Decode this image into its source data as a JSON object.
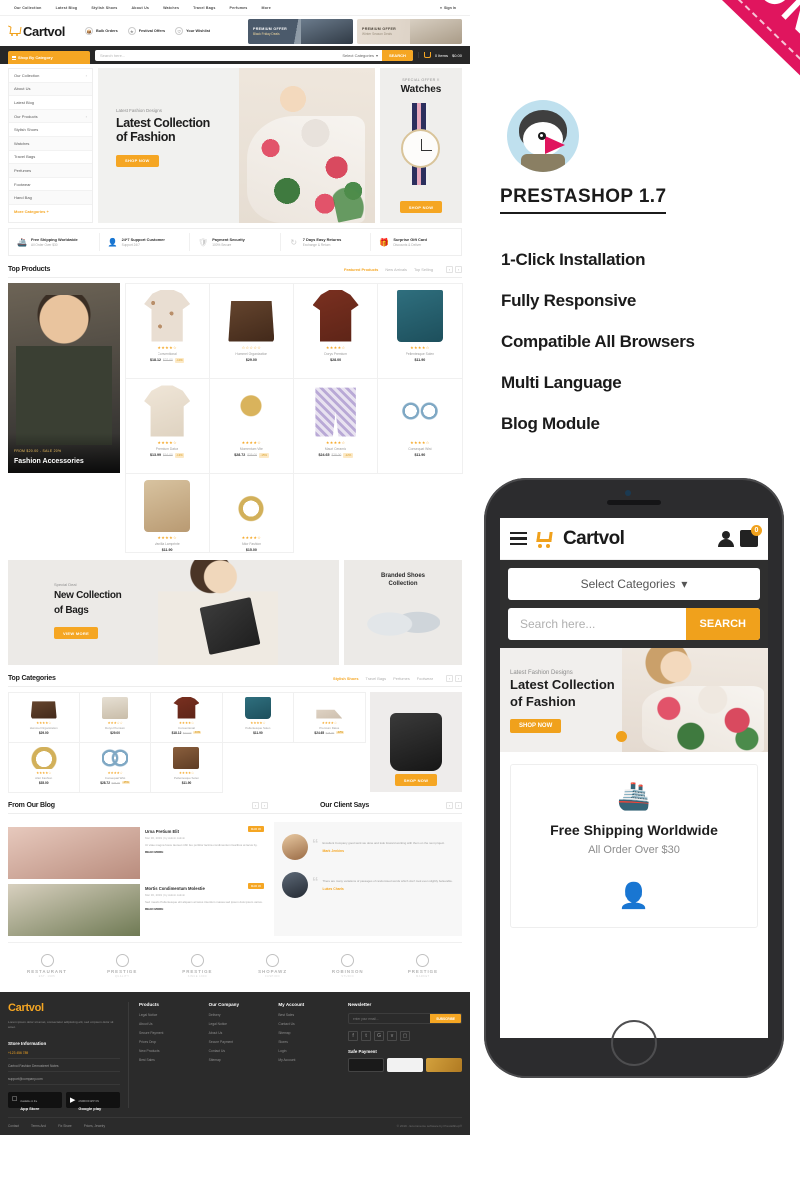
{
  "desktop": {
    "top_nav": {
      "links": [
        "Our Collection",
        "Latest Blog",
        "Stylish Shoes",
        "About Us",
        "Watches",
        "Travel Bags",
        "Perfumes",
        "More"
      ],
      "signin": "Sign In"
    },
    "brand": {
      "name": "Cartvol",
      "cart_icon": "shopping-cart-icon"
    },
    "header_features": [
      {
        "icon": "bulk-orders-icon",
        "label": "Bulk Orders"
      },
      {
        "icon": "festival-offers-icon",
        "label": "Festival Offers"
      },
      {
        "icon": "wishlist-icon",
        "label": "Your Wishlist"
      }
    ],
    "header_banners": [
      {
        "title": "PREMIUM OFFER",
        "subtitle": "Black Friday Deals"
      },
      {
        "title": "PREMIUM OFFER",
        "subtitle": "Winter Season Deals"
      }
    ],
    "search": {
      "shop_by": "Shop By Category",
      "placeholder": "Search here...",
      "select_categories": "Select Categories",
      "button": "SEARCH",
      "cart_items": "0 Items",
      "cart_total": "$0.00"
    },
    "side_menu": [
      {
        "label": "Our Collection",
        "has_arrow": true
      },
      {
        "label": "About Us",
        "has_arrow": false
      },
      {
        "label": "Latest Blog",
        "has_arrow": false
      },
      {
        "label": "Our Products",
        "has_arrow": true
      },
      {
        "label": "Stylish Shoes",
        "has_arrow": false
      },
      {
        "label": "Watches",
        "has_arrow": false
      },
      {
        "label": "Travel Bags",
        "has_arrow": false
      },
      {
        "label": "Perfumes",
        "has_arrow": false
      },
      {
        "label": "Footwear",
        "has_arrow": false
      },
      {
        "label": "Hand Bag",
        "has_arrow": false
      },
      {
        "label": "More Categories +",
        "has_arrow": false
      }
    ],
    "hero": {
      "pretitle": "Latest Fashion Designs",
      "line1": "Latest Collection",
      "line2": "of Fashion",
      "cta": "SHOP NOW"
    },
    "watch_panel": {
      "pretitle": "SPECIAL OFFER !!",
      "title": "Watches",
      "cta": "SHOP NOW"
    },
    "services": [
      {
        "icon": "ship-icon",
        "title": "Free Shipping Worldwide",
        "sub": "All Order Over $30"
      },
      {
        "icon": "support-icon",
        "title": "24*7 Support Customer",
        "sub": "Support 24/7"
      },
      {
        "icon": "shield-icon",
        "title": "Payment Security",
        "sub": "100% Secure"
      },
      {
        "icon": "return-icon",
        "title": "7 Days Easy Returns",
        "sub": "Exchange & Return"
      },
      {
        "icon": "gift-icon",
        "title": "Surprise Gift Card",
        "sub": "Discounts & Deliver"
      }
    ],
    "top_products": {
      "title": "Top Products",
      "tabs": [
        "Featured Products",
        "New Arrivals",
        "Top Selling"
      ],
      "active_tab": "Featured Products",
      "featured_card": {
        "tag": "FROM $20.00 - SALE 20%",
        "title": "Fashion Accessories"
      },
      "items": [
        {
          "shape": "sh-shirt",
          "stars": "★★★★☆",
          "name": "Conventional",
          "price": "$18.12",
          "old": "$22.00",
          "off": "-10%"
        },
        {
          "shape": "sh-bag",
          "stars": "☆☆☆☆☆",
          "name": "Hummel Organization",
          "price": "$29.00",
          "old": "",
          "off": ""
        },
        {
          "shape": "sh-tshirt",
          "stars": "★★★★☆",
          "name": "Dorys Premium",
          "price": "$28.00",
          "old": "",
          "off": ""
        },
        {
          "shape": "sh-tote",
          "stars": "★★★★☆",
          "name": "Pellentesque Solen",
          "price": "$11.90",
          "old": "",
          "off": ""
        },
        {
          "shape": "sh-sweater",
          "stars": "★★★★☆",
          "name": "Premium Datus",
          "price": "$13.99",
          "old": "$16.00",
          "off": "-13%"
        },
        {
          "shape": "sh-ear",
          "stars": "★★★★☆",
          "name": "Momentum Vite",
          "price": "$28.72",
          "old": "$35.00",
          "off": "-15%"
        },
        {
          "shape": "sh-short",
          "stars": "★★★★☆",
          "name": "Mauri Ceramic",
          "price": "$24.65",
          "old": "$28.00",
          "off": "-12%"
        },
        {
          "shape": "sh-glass",
          "stars": "★★★★☆",
          "name": "Consequat Wist",
          "price": "$11.90",
          "old": "",
          "off": ""
        },
        {
          "shape": "sh-hbag",
          "stars": "★★★★☆",
          "name": "Vanilla Lamprinte",
          "price": "$11.90",
          "old": "",
          "off": ""
        },
        {
          "shape": "sh-ring",
          "stars": "★★★★☆",
          "name": "Altor Fashion",
          "price": "$15.00",
          "old": "",
          "off": ""
        }
      ]
    },
    "promo_banners": {
      "left": {
        "pretitle": "Special Deal",
        "line1": "New Collection",
        "line2": "of Bags",
        "cta": "VIEW MORE"
      },
      "right": {
        "line1": "Branded Shoes",
        "line2": "Collection"
      }
    },
    "top_categories": {
      "title": "Top Categories",
      "tabs": [
        "Stylish Shoes",
        "Travel Bags",
        "Perfumes",
        "Footwear"
      ],
      "active_tab": "Stylish Shoes",
      "items": [
        {
          "shape": "sh-bag",
          "stars": "★★★★☆",
          "name": "Hummel Organization",
          "price": "$29.00",
          "old": "",
          "off": ""
        },
        {
          "shape": "sh-perf",
          "stars": "★★★☆☆",
          "name": "Dorys Premium",
          "price": "$29.00",
          "old": "",
          "off": ""
        },
        {
          "shape": "sh-tshirt",
          "stars": "★★★★☆",
          "name": "Conventional",
          "price": "$18.12",
          "old": "$22.00",
          "off": "-10%"
        },
        {
          "shape": "sh-tote",
          "stars": "★★★★☆",
          "name": "Pellentesque Solen",
          "price": "$11.90",
          "old": "",
          "off": ""
        },
        {
          "shape": "sh-heels",
          "stars": "★★★★☆",
          "name": "Premium Datus",
          "price": "$24.65",
          "old": "$28.00",
          "off": "-12%"
        },
        {
          "shape": "sh-ring",
          "stars": "★★★★☆",
          "name": "Altor Fashion",
          "price": "$35.00",
          "old": "",
          "off": ""
        },
        {
          "shape": "sh-glass",
          "stars": "★★★★☆",
          "name": "Consequat Wist",
          "price": "$28.72",
          "old": "$35.00",
          "off": "-15%"
        },
        {
          "shape": "sh-wallet",
          "stars": "★★★★☆",
          "name": "Pellentesque Solen",
          "price": "$11.90",
          "old": "",
          "off": ""
        }
      ],
      "big_card_cta": "SHOP NOW"
    },
    "blog": {
      "title": "From Our Blog",
      "posts": [
        {
          "date_badge": "MAR 30",
          "title": "Urna Pretium Elit",
          "meta": "Mar 30, 2019  |  by Admin Admin",
          "excerpt": "Ut vitae magna fusce laoreet nibh feu porttitor lacinia condimentum faucibus at lacus by.",
          "read_more": "READ MORE",
          "thumb": "bt-1"
        },
        {
          "date_badge": "MAR 30",
          "title": "Mortis Condimentum Molestie",
          "meta": "Mar 30, 2019  |  by Admin Admin",
          "excerpt": "Sed mauris Pellentesque elit aliquam at lacus interdum massa sed ipsum duis ipsum varius.",
          "read_more": "READ MORE",
          "thumb": "bt-2"
        }
      ]
    },
    "testimonials": {
      "title": "Our Client Says",
      "items": [
        {
          "quote": "Excellent Company good work we done and look forward working with them on the next project.",
          "name": "Mark Jenkins",
          "avatar": "av-1"
        },
        {
          "quote": "There are many variations of passages of randomised words which don't look even slightly believable.",
          "name": "Lukes Charls",
          "avatar": "av-2"
        }
      ]
    },
    "brand_logos": [
      {
        "name": "RESTAURANT",
        "sub": "EST. 1985"
      },
      {
        "name": "PRESTIGE",
        "sub": "QUALITY"
      },
      {
        "name": "PRESTIGE",
        "sub": "SINCE 1990"
      },
      {
        "name": "SHOPAWZ",
        "sub": "FASHION"
      },
      {
        "name": "ROBINSON",
        "sub": "STUDIO"
      },
      {
        "name": "PRESTIGE",
        "sub": "MARKET"
      }
    ],
    "footer": {
      "brand": "Cartvol",
      "about": "Lorem ipsum dolor sit amet, consectetur adipiscing elit, sed ut ipsum dolor sit amet.",
      "store_info_title": "Store Information",
      "phone": "+123 456 789",
      "address": "Cartvol Fashion Demostreet Notes",
      "email": "support@company.com",
      "app_store": {
        "top": "Available on the",
        "name": "App Store"
      },
      "google_play": {
        "top": "ANDROID APP ON",
        "name": "Google play"
      },
      "columns": [
        {
          "title": "Products",
          "links": [
            "Legal Notice",
            "About Us",
            "Secure Payment",
            "Prices Drop",
            "New Products",
            "Best Sales"
          ]
        },
        {
          "title": "Our Company",
          "links": [
            "Delivery",
            "Legal Notice",
            "About Us",
            "Secure Payment",
            "Contact Us",
            "Sitemap"
          ]
        },
        {
          "title": "My Account",
          "links": [
            "Best Sales",
            "Contact Us",
            "Sitemap",
            "Stores",
            "Login",
            "My Account"
          ]
        }
      ],
      "newsletter": {
        "title": "Newsletter",
        "placeholder": "enter your email...",
        "button": "SUBSCRIBE"
      },
      "socials": [
        "facebook-icon",
        "twitter-icon",
        "google-plus-icon",
        "vimeo-icon",
        "instagram-icon"
      ],
      "safe_payment_title": "Safe Payment",
      "bottom_links": [
        "Contact",
        "Terms And",
        "Fix Share",
        "Prices, Jewelry"
      ],
      "copyright": "© 2019 - Ecommerce software by PrestaShop®"
    }
  },
  "right_panel": {
    "ribbon": "RESPONSIVE",
    "logo": "prestashop-logo-icon",
    "platform": "PRESTASHOP 1.7",
    "features": [
      "1-Click Installation",
      "Fully Responsive",
      "Compatible All Browsers",
      "Multi Language",
      "Blog Module"
    ]
  },
  "phone": {
    "header": {
      "menu_icon": "hamburger-menu-icon",
      "brand": "Cartvol",
      "account_icon": "user-account-icon",
      "cart_icon": "shopping-bag-icon",
      "cart_count": "0"
    },
    "select_categories": "Select Categories",
    "search_placeholder": "Search here...",
    "search_button": "SEARCH",
    "hero": {
      "pretitle": "Latest Fashion Designs",
      "line1": "Latest Collection",
      "line2": "of Fashion",
      "cta": "SHOP NOW"
    },
    "service": {
      "icon": "ship-icon",
      "title": "Free Shipping Worldwide",
      "sub": "All Order Over $30",
      "second_icon": "support-agent-icon"
    }
  },
  "colors": {
    "accent": "#f5a623",
    "ribbon": "#e0155e",
    "dark": "#2b2b2b"
  }
}
